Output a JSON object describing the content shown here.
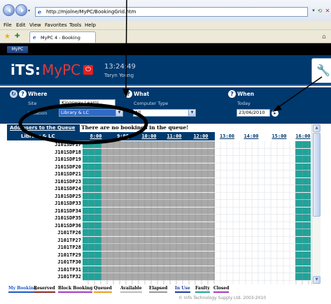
{
  "browser": {
    "address": "http://mjolne/MyPC/BookingGrid.htm",
    "menu": [
      "File",
      "Edit",
      "View",
      "Favorites",
      "Tools",
      "Help"
    ],
    "tab_title": "MyPC 4 - Booking"
  },
  "app": {
    "tag": "MyPC",
    "logo_its": "iTS:",
    "logo_mypc": "MyPC",
    "time": "13:24:49",
    "user": "Taryn Young"
  },
  "filters": {
    "where": {
      "heading": "Where",
      "site_label": "Site",
      "site_value": "Kingsway Learni...",
      "location_label": "Location",
      "location_value": "Library & LC"
    },
    "what": {
      "heading": "What",
      "type_label": "Computer Type",
      "type_value": "All"
    },
    "when": {
      "heading": "When",
      "today_label": "Today",
      "date_value": "23/06/2010"
    }
  },
  "grid": {
    "add_link": "Add users to the Queue",
    "queue_message": "There are no bookings in the queue!",
    "location_header": "Library & LC",
    "time_slots": [
      "8:00",
      "9:00",
      "10:00",
      "11:00",
      "12:00",
      "13:00",
      "14:00",
      "15:00",
      "16:00"
    ],
    "rows": [
      "J101SDP17",
      "J101SDP18",
      "J101SDP19",
      "J101SDP20",
      "J101SDP21",
      "J101SDP23",
      "J101SDP24",
      "J101SDP25",
      "J101SDP33",
      "J101SDP34",
      "J101SDP35",
      "J101SDP36",
      "J101TP26",
      "J101TP27",
      "J101TP28",
      "J101TP29",
      "J101TP30",
      "J101TP31",
      "J101TP32"
    ]
  },
  "legend": [
    {
      "label": "My Booking",
      "color": "#1f58c9"
    },
    {
      "label": "Reserved",
      "color": "#8b2a2a"
    },
    {
      "label": "Block Booking",
      "color": "#a63dbd"
    },
    {
      "label": "Queued",
      "color": "#e8a020"
    },
    {
      "label": "Available",
      "color": "#bbbbbb"
    },
    {
      "label": "Elapsed",
      "color": "#999999"
    },
    {
      "label": "In Use",
      "color": "#1f3f9a"
    },
    {
      "label": "Faulty",
      "color": "#1ea39a"
    },
    {
      "label": "Closed",
      "color": "#a63dbd"
    }
  ],
  "footer": {
    "copyright": "© Info Technology Supply Ltd. 2003-2010"
  },
  "colors": {
    "header_blue": "#00396e",
    "teal": "#1ea39a",
    "elapsed_grey": "#a9a9a9",
    "accent_red": "#e03a3a"
  }
}
